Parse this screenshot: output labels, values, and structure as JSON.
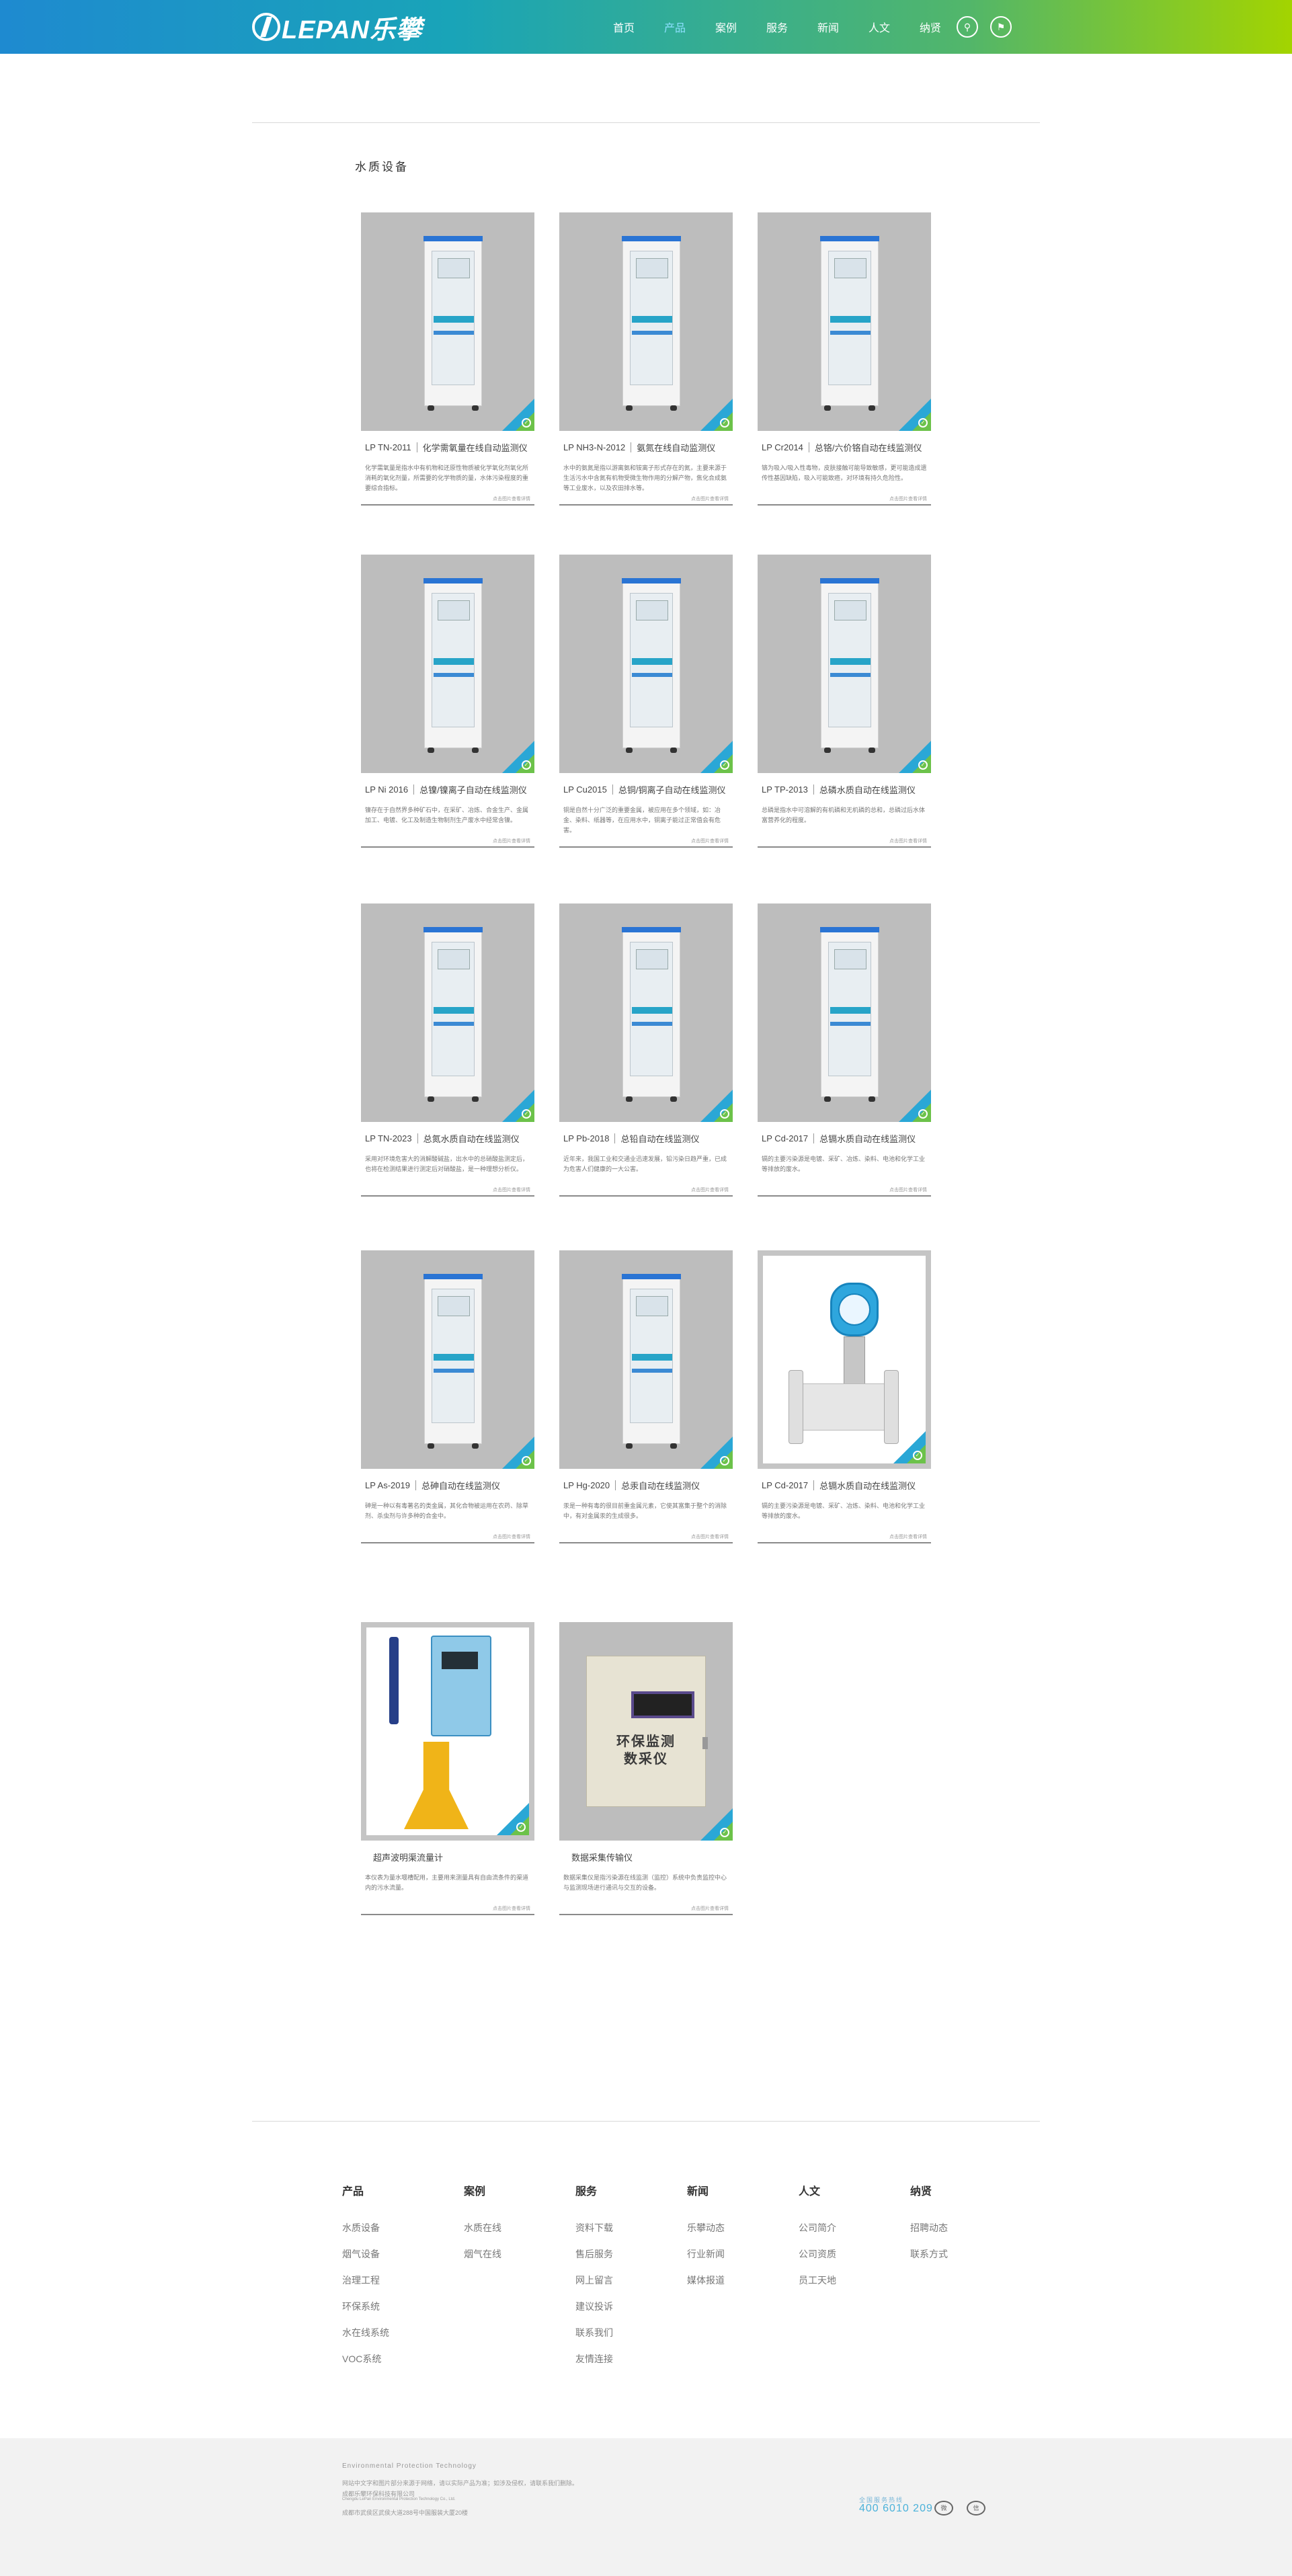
{
  "header": {
    "logo_text": "LEPAN乐攀",
    "nav": [
      "首页",
      "产品",
      "案例",
      "服务",
      "新闻",
      "人文",
      "纳贤"
    ],
    "active_nav": "产品",
    "icons": [
      "search-icon",
      "flag-icon"
    ]
  },
  "section": {
    "title": "水质设备"
  },
  "card_source": "点击图片查看详情",
  "products": [
    {
      "model": "LP TN-2011",
      "name": "化学需氧量在线自动监测仪",
      "desc": "化学需氧量是指水中有机物和还原性物质被化学氧化剂氧化所消耗的氧化剂量，所需要的化学物质的量，水体污染程度的重要综合指标。",
      "image": "cabinet"
    },
    {
      "model": "LP NH3-N-2012",
      "name": "氨氮在线自动监测仪",
      "desc": "水中的氨氮是指以游离氨和铵离子形式存在的氮，主要来源于生活污水中含氮有机物受微生物作用的分解产物，焦化合成氨等工业废水，以及农田排水等。",
      "image": "cabinet"
    },
    {
      "model": "LP Cr2014",
      "name": "总铬/六价铬自动在线监测仪",
      "desc": "铬为吸入/吸入性毒物，皮肤接触可能导致敏感，更可能造成遗传性基因缺陷，吸入可能致癌，对环境有持久危险性。",
      "image": "cabinet"
    },
    {
      "model": "LP Ni 2016",
      "name": "总镍/镍离子自动在线监测仪",
      "desc": "镍存在于自然界多种矿石中，在采矿、冶炼、合金生产、金属加工、电镀、化工及制造生物制剂生产废水中经常含镍。",
      "image": "cabinet"
    },
    {
      "model": "LP Cu2015",
      "name": "总铜/铜离子自动在线监测仪",
      "desc": "铜是自然十分广泛的重要金属，被应用在多个领域，如：冶金、染料、纸器等，在应用水中，铜离子能过正常值会有危害。",
      "image": "cabinet"
    },
    {
      "model": "LP TP-2013",
      "name": "总磷水质自动在线监测仪",
      "desc": "总磷是指水中可溶解的有机磷和无机磷的总和，总磷过后水体富营养化的程度。",
      "image": "cabinet"
    },
    {
      "model": "LP TN-2023",
      "name": "总氮水质自动在线监测仪",
      "desc": "采用对环境危害大的消解酸碱盐，出水中的总硝酸盐测定后，也将在检测结果进行测定后对硝酸盐，是一种理想分析仪。",
      "image": "cabinet"
    },
    {
      "model": "LP Pb-2018",
      "name": "总铅自动在线监测仪",
      "desc": "近年来，我国工业和交通业迅速发展，铅污染日趋严重，已成为危害人们健康的一大公害。",
      "image": "cabinet"
    },
    {
      "model": "LP Cd-2017",
      "name": "总镉水质自动在线监测仪",
      "desc": "镉的主要污染源是电镀、采矿、冶炼、染料、电池和化学工业等排放的废水。",
      "image": "cabinet"
    },
    {
      "model": "LP As-2019",
      "name": "总砷自动在线监测仪",
      "desc": "砷是一种以有毒著名的类金属，其化合物被运用在农药、除草剂、杀虫剂与许多种的合金中。",
      "image": "cabinet"
    },
    {
      "model": "LP Hg-2020",
      "name": "总汞自动在线监测仪",
      "desc": "汞是一种有毒的很目前重金属元素，它使其富集于整个的消除中，有对金属汞的生成很多。",
      "image": "cabinet"
    },
    {
      "model": "LP Cd-2017",
      "name": "总镉水质自动在线监测仪",
      "desc": "镉的主要污染源是电镀、采矿、冶炼、染料、电池和化学工业等排放的废水。",
      "image": "flowmeter"
    },
    {
      "model": "",
      "name": "超声波明渠流量计",
      "desc": "本仪表为量水堰槽配用，主要用来测量具有自由流条件的渠道内的污水流量。",
      "image": "ultrasonic"
    },
    {
      "model": "",
      "name": "数据采集传输仪",
      "desc": "数据采集仪是指污染源在线监测（监控）系统中负责监控中心与监测现场进行通讯与交互的设备。",
      "image": "databox"
    }
  ],
  "databox_label": "环保监测\n数采仪",
  "footer": {
    "columns": [
      {
        "title": "产品",
        "links": [
          "水质设备",
          "烟气设备",
          "治理工程",
          "环保系统",
          "水在线系统",
          "VOC系统"
        ]
      },
      {
        "title": "案例",
        "links": [
          "水质在线",
          "烟气在线"
        ]
      },
      {
        "title": "服务",
        "links": [
          "资料下载",
          "售后服务",
          "网上留言",
          "建议投诉",
          "联系我们",
          "友情连接"
        ]
      },
      {
        "title": "新闻",
        "links": [
          "乐攀动态",
          "行业新闻",
          "媒体报道"
        ]
      },
      {
        "title": "人文",
        "links": [
          "公司简介",
          "公司资质",
          "员工天地"
        ]
      },
      {
        "title": "纳贤",
        "links": [
          "招聘动态",
          "联系方式"
        ]
      }
    ],
    "bottom": {
      "tagline": "Environmental Protection Technology",
      "line1": "网站中文字和图片部分来源于网络，请以实际产品为准；如涉及侵权，请联系我们删除。",
      "line2": "成都乐攀环保科技有限公司",
      "line3": "Chengdu LePan Environmental Protection Technology Co., Ltd.",
      "line4": "成都市武侯区武侯大道288号中国服装大厦20楼",
      "hotline_label": "全国服务热线",
      "hotline": "400 6010 209",
      "social": [
        "weibo-icon",
        "wechat-icon"
      ]
    }
  }
}
